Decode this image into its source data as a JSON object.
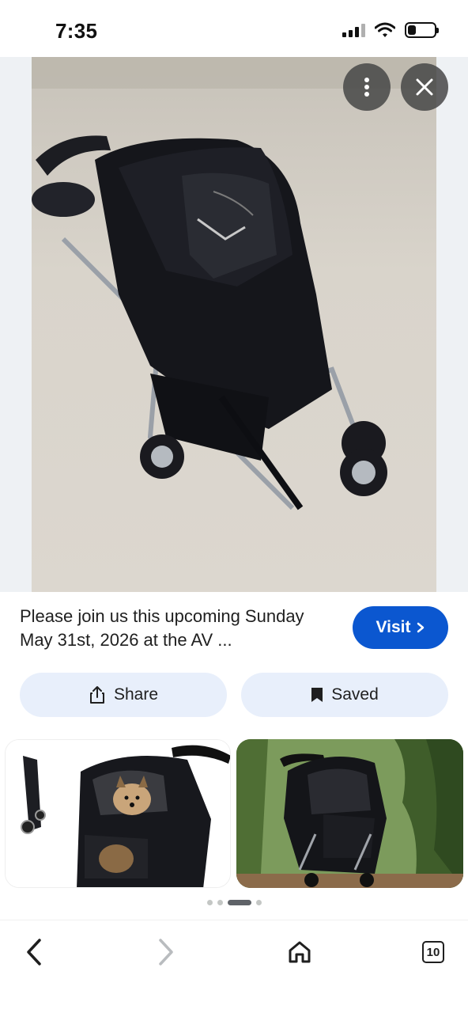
{
  "status_bar": {
    "time": "7:35",
    "battery_level": 0.3,
    "icons": [
      "signal-icon",
      "wifi-icon",
      "battery-icon"
    ]
  },
  "viewer": {
    "image_subject": "black three-wheel pet stroller",
    "more_icon": "more-vertical-icon",
    "close_icon": "close-icon"
  },
  "result": {
    "caption": "Please join us this upcoming Sunday May 31st, 2026 at the AV ...",
    "visit_label": "Visit",
    "visit_icon": "chevron-right-icon",
    "share_label": "Share",
    "share_icon": "share-icon",
    "saved_label": "Saved",
    "saved_icon": "bookmark-icon"
  },
  "related": {
    "thumbnails": [
      {
        "subject": "black pet stroller with small dog"
      },
      {
        "subject": "black pet stroller outdoors in front of trees"
      }
    ],
    "pager_count": 4,
    "pager_active": 2
  },
  "bottom_nav": {
    "back_icon": "back-icon",
    "forward_icon": "forward-icon",
    "home_icon": "home-icon",
    "tabs_count": "10"
  },
  "colors": {
    "accent": "#0b57d0",
    "pill_bg": "#e8effb",
    "overlay_btn": "#464646"
  }
}
